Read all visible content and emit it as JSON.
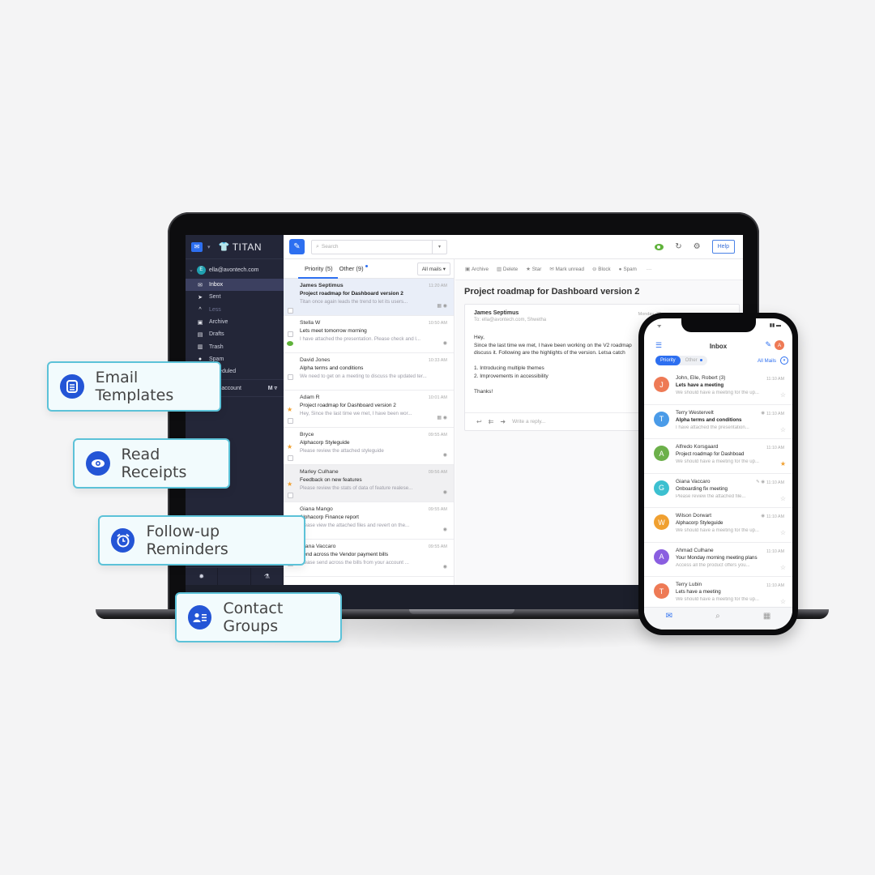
{
  "app": {
    "name": "TITAN"
  },
  "sidebar": {
    "account": "ella@avontech.com",
    "account_initial": "E",
    "items": [
      {
        "icon": "inbox-icon",
        "glyph": "✉",
        "label": "Inbox",
        "active": true
      },
      {
        "icon": "sent-icon",
        "glyph": "➤",
        "label": "Sent"
      },
      {
        "icon": "chevron-up-icon",
        "glyph": "^",
        "label": "Less",
        "muted": true
      },
      {
        "icon": "archive-icon",
        "glyph": "▣",
        "label": "Archive"
      },
      {
        "icon": "drafts-icon",
        "glyph": "▤",
        "label": "Drafts"
      },
      {
        "icon": "trash-icon",
        "glyph": "▥",
        "label": "Trash"
      },
      {
        "icon": "spam-icon",
        "glyph": "●",
        "label": "Spam"
      },
      {
        "icon": "scheduled-icon",
        "glyph": "◷",
        "label": "Scheduled"
      }
    ],
    "add_account": "Add account"
  },
  "toolbar": {
    "search_placeholder": "Search",
    "help_label": "Help"
  },
  "list": {
    "tabs": [
      {
        "label": "Priority (5)",
        "active": true
      },
      {
        "label": "Other (9)",
        "unread_dot": true
      }
    ],
    "filter": "All mails ▾",
    "mails": [
      {
        "from": "James Septimus",
        "subject": "Project roadmap for Dashboard version 2",
        "preview": "Titan once again leads the trend to let its users...",
        "time": "11:20 AM",
        "selected": true,
        "bold": true,
        "icons": "▦ ◉"
      },
      {
        "from": "Stella W",
        "subject": "Lets meet tomorrow morning",
        "preview": "I have attached the presentation. Please check and l...",
        "time": "10:50 AM",
        "icons": "◉",
        "read_receipt": true
      },
      {
        "from": "David Jones",
        "subject": "Alpha terms and conditions",
        "preview": "We need to get on a meeting to discuss the updated ter...",
        "time": "10:33 AM",
        "icons": ""
      },
      {
        "from": "Adam R",
        "subject": "Project roadmap for Dashboard version 2",
        "preview": "Hey, Since the last time we met, I have been wor...",
        "time": "10:01 AM",
        "starred": true,
        "icons": "▦ ◉"
      },
      {
        "from": "Bryce",
        "subject": "Alphacorp Styleguide",
        "preview": "Please review the attached styleguide",
        "time": "09:55 AM",
        "starred": true,
        "icons": "◉"
      },
      {
        "from": "Marley Culhane",
        "subject": "Feedback on new features",
        "preview": "Please review the stats of data of feature realese...",
        "time": "09:56 AM",
        "starred": true,
        "hover": true,
        "icons": "◉"
      },
      {
        "from": "Giana Mango",
        "subject": "Alphacorp Finance report",
        "preview": "Please view the attached files and revert on the...",
        "time": "09:55 AM",
        "icons": "◉"
      },
      {
        "from": "Giana Vaccaro",
        "subject": "Send across the Vendor payment bills",
        "preview": "Please send across the bills from your account ...",
        "time": "09:55 AM",
        "icons": "◉"
      }
    ]
  },
  "reader": {
    "actions": [
      {
        "icon": "archive-icon",
        "glyph": "▣",
        "label": "Archive"
      },
      {
        "icon": "delete-icon",
        "glyph": "▥",
        "label": "Delete"
      },
      {
        "icon": "star-icon",
        "glyph": "★",
        "label": "Star"
      },
      {
        "icon": "mark-unread-icon",
        "glyph": "✉",
        "label": "Mark unread"
      },
      {
        "icon": "block-icon",
        "glyph": "⊖",
        "label": "Block"
      },
      {
        "icon": "spam-icon",
        "glyph": "●",
        "label": "Spam"
      },
      {
        "icon": "more-icon",
        "glyph": "",
        "label": "···"
      }
    ],
    "title": "Project roadmap for Dashboard version 2",
    "from": "James Septimus",
    "to": "To: ella@avontech.com, Shwetha",
    "date": "Monday, 30",
    "body": "Hey,\nSince the last time we met, I have been working on the V2 roadmap\ndiscuss it. Following are the highlights of the version. Letsa catch\n\n1. Introducing multiple themes\n2. Improvements in accessibility\n\nThanks!",
    "reply_placeholder": "Write a reply..."
  },
  "phone": {
    "title": "Inbox",
    "user_initial": "A",
    "filters": [
      {
        "label": "Priority",
        "active": true
      },
      {
        "label": "Other",
        "dot": true
      }
    ],
    "all_mails": "All Mails",
    "mails": [
      {
        "initial": "J",
        "color": "#ee7a55",
        "from": "John, Elle, Robert (3)",
        "subject": "Lets have a meeting",
        "preview": "We should have a meeting for the up...",
        "time": "11:10 AM",
        "bold": true
      },
      {
        "initial": "T",
        "color": "#4a9be8",
        "from": "Terry Westervelt",
        "subject": "Alpha terms and conditions",
        "preview": "I have attached the presentation...",
        "time": "11:10 AM",
        "bold": true,
        "icon": "◉"
      },
      {
        "initial": "A",
        "color": "#6cb04a",
        "from": "Alfredo Korsgaard",
        "subject": "Project roadmap for Dashboad",
        "preview": "We should have a meeting for the up...",
        "time": "11:10 AM",
        "starred": true
      },
      {
        "initial": "G",
        "color": "#3cc0d0",
        "from": "Giana Vaccaro",
        "subject": "Onboarding fix meeting",
        "preview": "Please review the attached file...",
        "time": "11:10 AM",
        "icon": "✎ ◉"
      },
      {
        "initial": "W",
        "color": "#f0a030",
        "from": "Wilson Dorwart",
        "subject": "Alphacorp Styleguide",
        "preview": "We should have a meeting for the up...",
        "time": "11:10 AM",
        "icon": "◉"
      },
      {
        "initial": "A",
        "color": "#8a5ee0",
        "from": "Ahmad Culhane",
        "subject": "Your Monday morning meeting plans",
        "preview": "Access all the product offers you...",
        "time": "11:10 AM"
      },
      {
        "initial": "T",
        "color": "#ee7a55",
        "from": "Terry Lubin",
        "subject": "Lets have a meeting",
        "preview": "We should have a meeting for the up...",
        "time": "11:10 AM"
      }
    ]
  },
  "features": [
    {
      "label": "Email Templates",
      "icon": "template-icon"
    },
    {
      "label": "Read Receipts",
      "icon": "eye-icon"
    },
    {
      "label": "Follow-up Reminders",
      "icon": "alarm-clock-icon"
    },
    {
      "label": "Contact Groups",
      "icon": "contact-card-icon"
    }
  ]
}
